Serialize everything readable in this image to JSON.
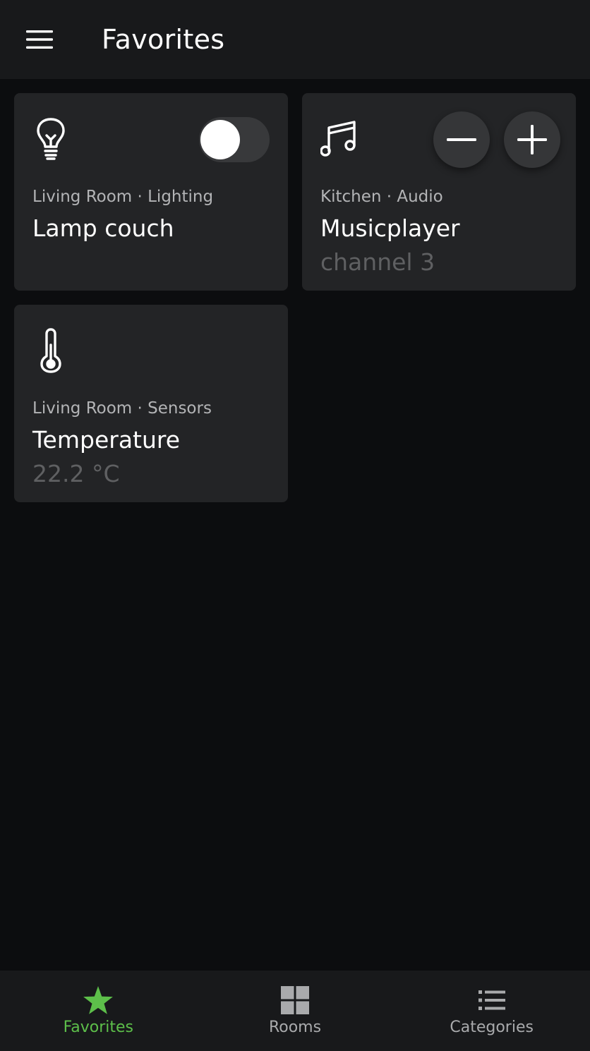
{
  "header": {
    "title": "Favorites",
    "menu_icon": "hamburger-menu-icon"
  },
  "colors": {
    "background": "#0c0d0f",
    "bar": "#18191b",
    "card": "#232426",
    "accent": "#5dbf4a"
  },
  "cards": [
    {
      "icon": "lightbulb-icon",
      "subtitle": "Living Room · Lighting",
      "name": "Lamp couch",
      "control": "toggle",
      "toggle_on": false
    },
    {
      "icon": "music-note-icon",
      "subtitle": "Kitchen · Audio",
      "name": "Musicplayer",
      "value": "channel 3",
      "control": "stepper"
    },
    {
      "icon": "thermometer-icon",
      "subtitle": "Living Room · Sensors",
      "name": "Temperature",
      "value": "22.2 °C"
    }
  ],
  "bottom_nav": [
    {
      "label": "Favorites",
      "icon": "star-icon",
      "active": true
    },
    {
      "label": "Rooms",
      "icon": "grid-icon",
      "active": false
    },
    {
      "label": "Categories",
      "icon": "list-icon",
      "active": false
    }
  ]
}
